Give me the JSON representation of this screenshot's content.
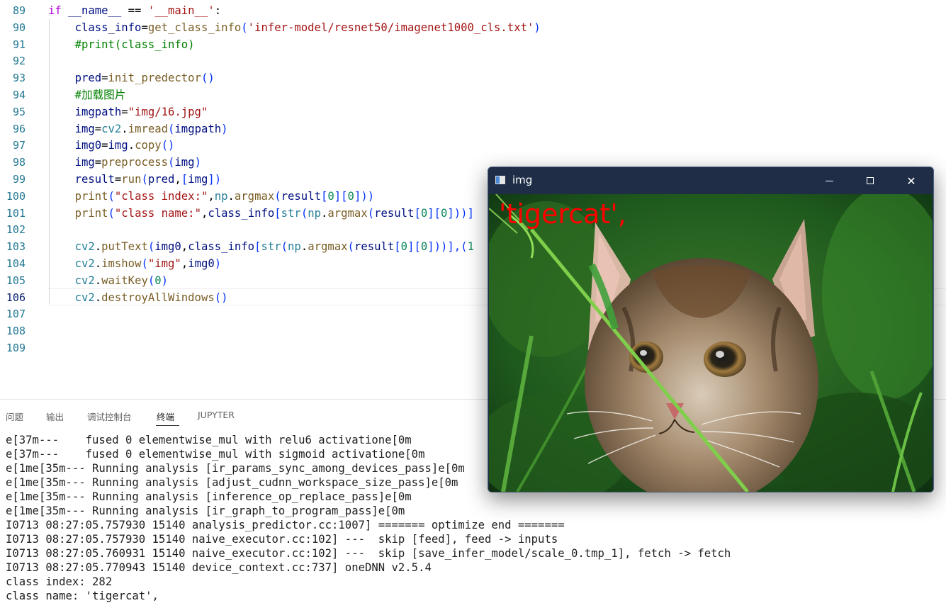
{
  "editor": {
    "active_line": "106",
    "lines": [
      {
        "n": "89",
        "segs": [
          [
            "if",
            "kw"
          ],
          " ",
          [
            "__name__",
            "var"
          ],
          " == ",
          [
            "'__main__'",
            "str"
          ],
          ":"
        ]
      },
      {
        "n": "90",
        "segs": [
          "    ",
          [
            "class_info",
            "var"
          ],
          "=",
          [
            "get_class_info",
            "fn"
          ],
          [
            "(",
            "bk"
          ],
          [
            "'infer-model/resnet50/imagenet1000_cls.txt'",
            "str"
          ],
          [
            ")",
            "bk"
          ]
        ]
      },
      {
        "n": "91",
        "segs": [
          "    ",
          [
            "#print(class_info)",
            "cm"
          ]
        ]
      },
      {
        "n": "92",
        "segs": [
          ""
        ]
      },
      {
        "n": "93",
        "segs": [
          "    ",
          [
            "pred",
            "var"
          ],
          "=",
          [
            "init_predector",
            "fn"
          ],
          [
            "()",
            "bk"
          ]
        ]
      },
      {
        "n": "94",
        "segs": [
          "    ",
          [
            "#加载图片",
            "cm"
          ]
        ]
      },
      {
        "n": "95",
        "segs": [
          "    ",
          [
            "imgpath",
            "var"
          ],
          "=",
          [
            "\"img/16.jpg\"",
            "str"
          ]
        ]
      },
      {
        "n": "96",
        "segs": [
          "    ",
          [
            "img",
            "var"
          ],
          "=",
          [
            "cv2",
            "ty"
          ],
          ".",
          [
            "imread",
            "fn"
          ],
          [
            "(",
            "bk"
          ],
          [
            "imgpath",
            "var"
          ],
          [
            ")",
            "bk"
          ]
        ]
      },
      {
        "n": "97",
        "segs": [
          "    ",
          [
            "img0",
            "var"
          ],
          "=",
          [
            "img",
            "var"
          ],
          ".",
          [
            "copy",
            "fn"
          ],
          [
            "()",
            "bk"
          ]
        ]
      },
      {
        "n": "98",
        "segs": [
          "    ",
          [
            "img",
            "var"
          ],
          "=",
          [
            "preprocess",
            "fn"
          ],
          [
            "(",
            "bk"
          ],
          [
            "img",
            "var"
          ],
          [
            ")",
            "bk"
          ]
        ]
      },
      {
        "n": "99",
        "segs": [
          "    ",
          [
            "result",
            "var"
          ],
          "=",
          [
            "run",
            "fn"
          ],
          [
            "(",
            "bk"
          ],
          [
            "pred",
            "var"
          ],
          ",",
          [
            "[",
            "bk"
          ],
          [
            "img",
            "var"
          ],
          [
            "])",
            "bk"
          ]
        ]
      },
      {
        "n": "100",
        "segs": [
          "    ",
          [
            "print",
            "fn"
          ],
          [
            "(",
            "bk"
          ],
          [
            "\"class index:\"",
            "str"
          ],
          ",",
          [
            "np",
            "ty"
          ],
          ".",
          [
            "argmax",
            "fn"
          ],
          [
            "(",
            "bk"
          ],
          [
            "result",
            "var"
          ],
          [
            "[",
            "bk"
          ],
          [
            "0",
            "nm"
          ],
          [
            "][",
            "bk"
          ],
          [
            "0",
            "nm"
          ],
          [
            "]))",
            "bk"
          ]
        ]
      },
      {
        "n": "101",
        "segs": [
          "    ",
          [
            "print",
            "fn"
          ],
          [
            "(",
            "bk"
          ],
          [
            "\"class name:\"",
            "str"
          ],
          ",",
          [
            "class_info",
            "var"
          ],
          [
            "[",
            "bk"
          ],
          [
            "str",
            "ty"
          ],
          [
            "(",
            "bk"
          ],
          [
            "np",
            "ty"
          ],
          ".",
          [
            "argmax",
            "fn"
          ],
          [
            "(",
            "bk"
          ],
          [
            "result",
            "var"
          ],
          [
            "[",
            "bk"
          ],
          [
            "0",
            "nm"
          ],
          [
            "][",
            "bk"
          ],
          [
            "0",
            "nm"
          ],
          [
            "]))]",
            "bk"
          ]
        ]
      },
      {
        "n": "102",
        "segs": [
          ""
        ]
      },
      {
        "n": "103",
        "segs": [
          "    ",
          [
            "cv2",
            "ty"
          ],
          ".",
          [
            "putText",
            "fn"
          ],
          [
            "(",
            "bk"
          ],
          [
            "img0",
            "var"
          ],
          ",",
          [
            "class_info",
            "var"
          ],
          [
            "[",
            "bk"
          ],
          [
            "str",
            "ty"
          ],
          [
            "(",
            "bk"
          ],
          [
            "np",
            "ty"
          ],
          ".",
          [
            "argmax",
            "fn"
          ],
          [
            "(",
            "bk"
          ],
          [
            "result",
            "var"
          ],
          [
            "[",
            "bk"
          ],
          [
            "0",
            "nm"
          ],
          [
            "][",
            "bk"
          ],
          [
            "0",
            "nm"
          ],
          [
            "]))],(",
            "bk"
          ],
          [
            "1",
            "nm"
          ]
        ]
      },
      {
        "n": "104",
        "segs": [
          "    ",
          [
            "cv2",
            "ty"
          ],
          ".",
          [
            "imshow",
            "fn"
          ],
          [
            "(",
            "bk"
          ],
          [
            "\"img\"",
            "str"
          ],
          ",",
          [
            "img0",
            "var"
          ],
          [
            ")",
            "bk"
          ]
        ]
      },
      {
        "n": "105",
        "segs": [
          "    ",
          [
            "cv2",
            "ty"
          ],
          ".",
          [
            "waitKey",
            "fn"
          ],
          [
            "(",
            "bk"
          ],
          [
            "0",
            "nm"
          ],
          [
            ")",
            "bk"
          ]
        ]
      },
      {
        "n": "106",
        "segs": [
          "    ",
          [
            "cv2",
            "ty"
          ],
          ".",
          [
            "destroyAllWindows",
            "fn"
          ],
          [
            "()",
            "bk"
          ]
        ]
      },
      {
        "n": "107",
        "segs": [
          ""
        ]
      },
      {
        "n": "108",
        "segs": [
          ""
        ]
      },
      {
        "n": "109",
        "segs": [
          ""
        ]
      }
    ]
  },
  "panel": {
    "tabs": [
      {
        "label": "问题",
        "active": false
      },
      {
        "label": "输出",
        "active": false
      },
      {
        "label": "调试控制台",
        "active": false
      },
      {
        "label": "终端",
        "active": true
      },
      {
        "label": "JUPYTER",
        "active": false
      }
    ],
    "terminal_lines": [
      "e[37m---    fused 0 elementwise_mul with relu6 activatione[0m",
      "e[37m---    fused 0 elementwise_mul with sigmoid activatione[0m",
      "e[1me[35m--- Running analysis [ir_params_sync_among_devices_pass]e[0m",
      "e[1me[35m--- Running analysis [adjust_cudnn_workspace_size_pass]e[0m",
      "e[1me[35m--- Running analysis [inference_op_replace_pass]e[0m",
      "e[1me[35m--- Running analysis [ir_graph_to_program_pass]e[0m",
      "I0713 08:27:05.757930 15140 analysis_predictor.cc:1007] ======= optimize end =======",
      "I0713 08:27:05.757930 15140 naive_executor.cc:102] ---  skip [feed], feed -> inputs",
      "I0713 08:27:05.760931 15140 naive_executor.cc:102] ---  skip [save_infer_model/scale_0.tmp_1], fetch -> fetch",
      "I0713 08:27:05.770943 15140 device_context.cc:737] oneDNN v2.5.4",
      "class index: 282",
      "class name: 'tigercat',"
    ]
  },
  "window": {
    "title": "img",
    "overlay_text": "'tigercat',",
    "min_glyph": "",
    "close_glyph": "✕",
    "icons": [
      "app-window-icon",
      "minimize-icon",
      "maximize-icon",
      "close-icon"
    ]
  },
  "colors": {
    "line_number": "#237893",
    "keyword": "#af00db",
    "function": "#795e26",
    "string": "#a31515",
    "comment": "#008000",
    "variable": "#001080",
    "type": "#267f99",
    "number": "#098658",
    "bracket": "#0431fa",
    "window_titlebar": "#1f2d47",
    "overlay_text": "#ff0000"
  }
}
